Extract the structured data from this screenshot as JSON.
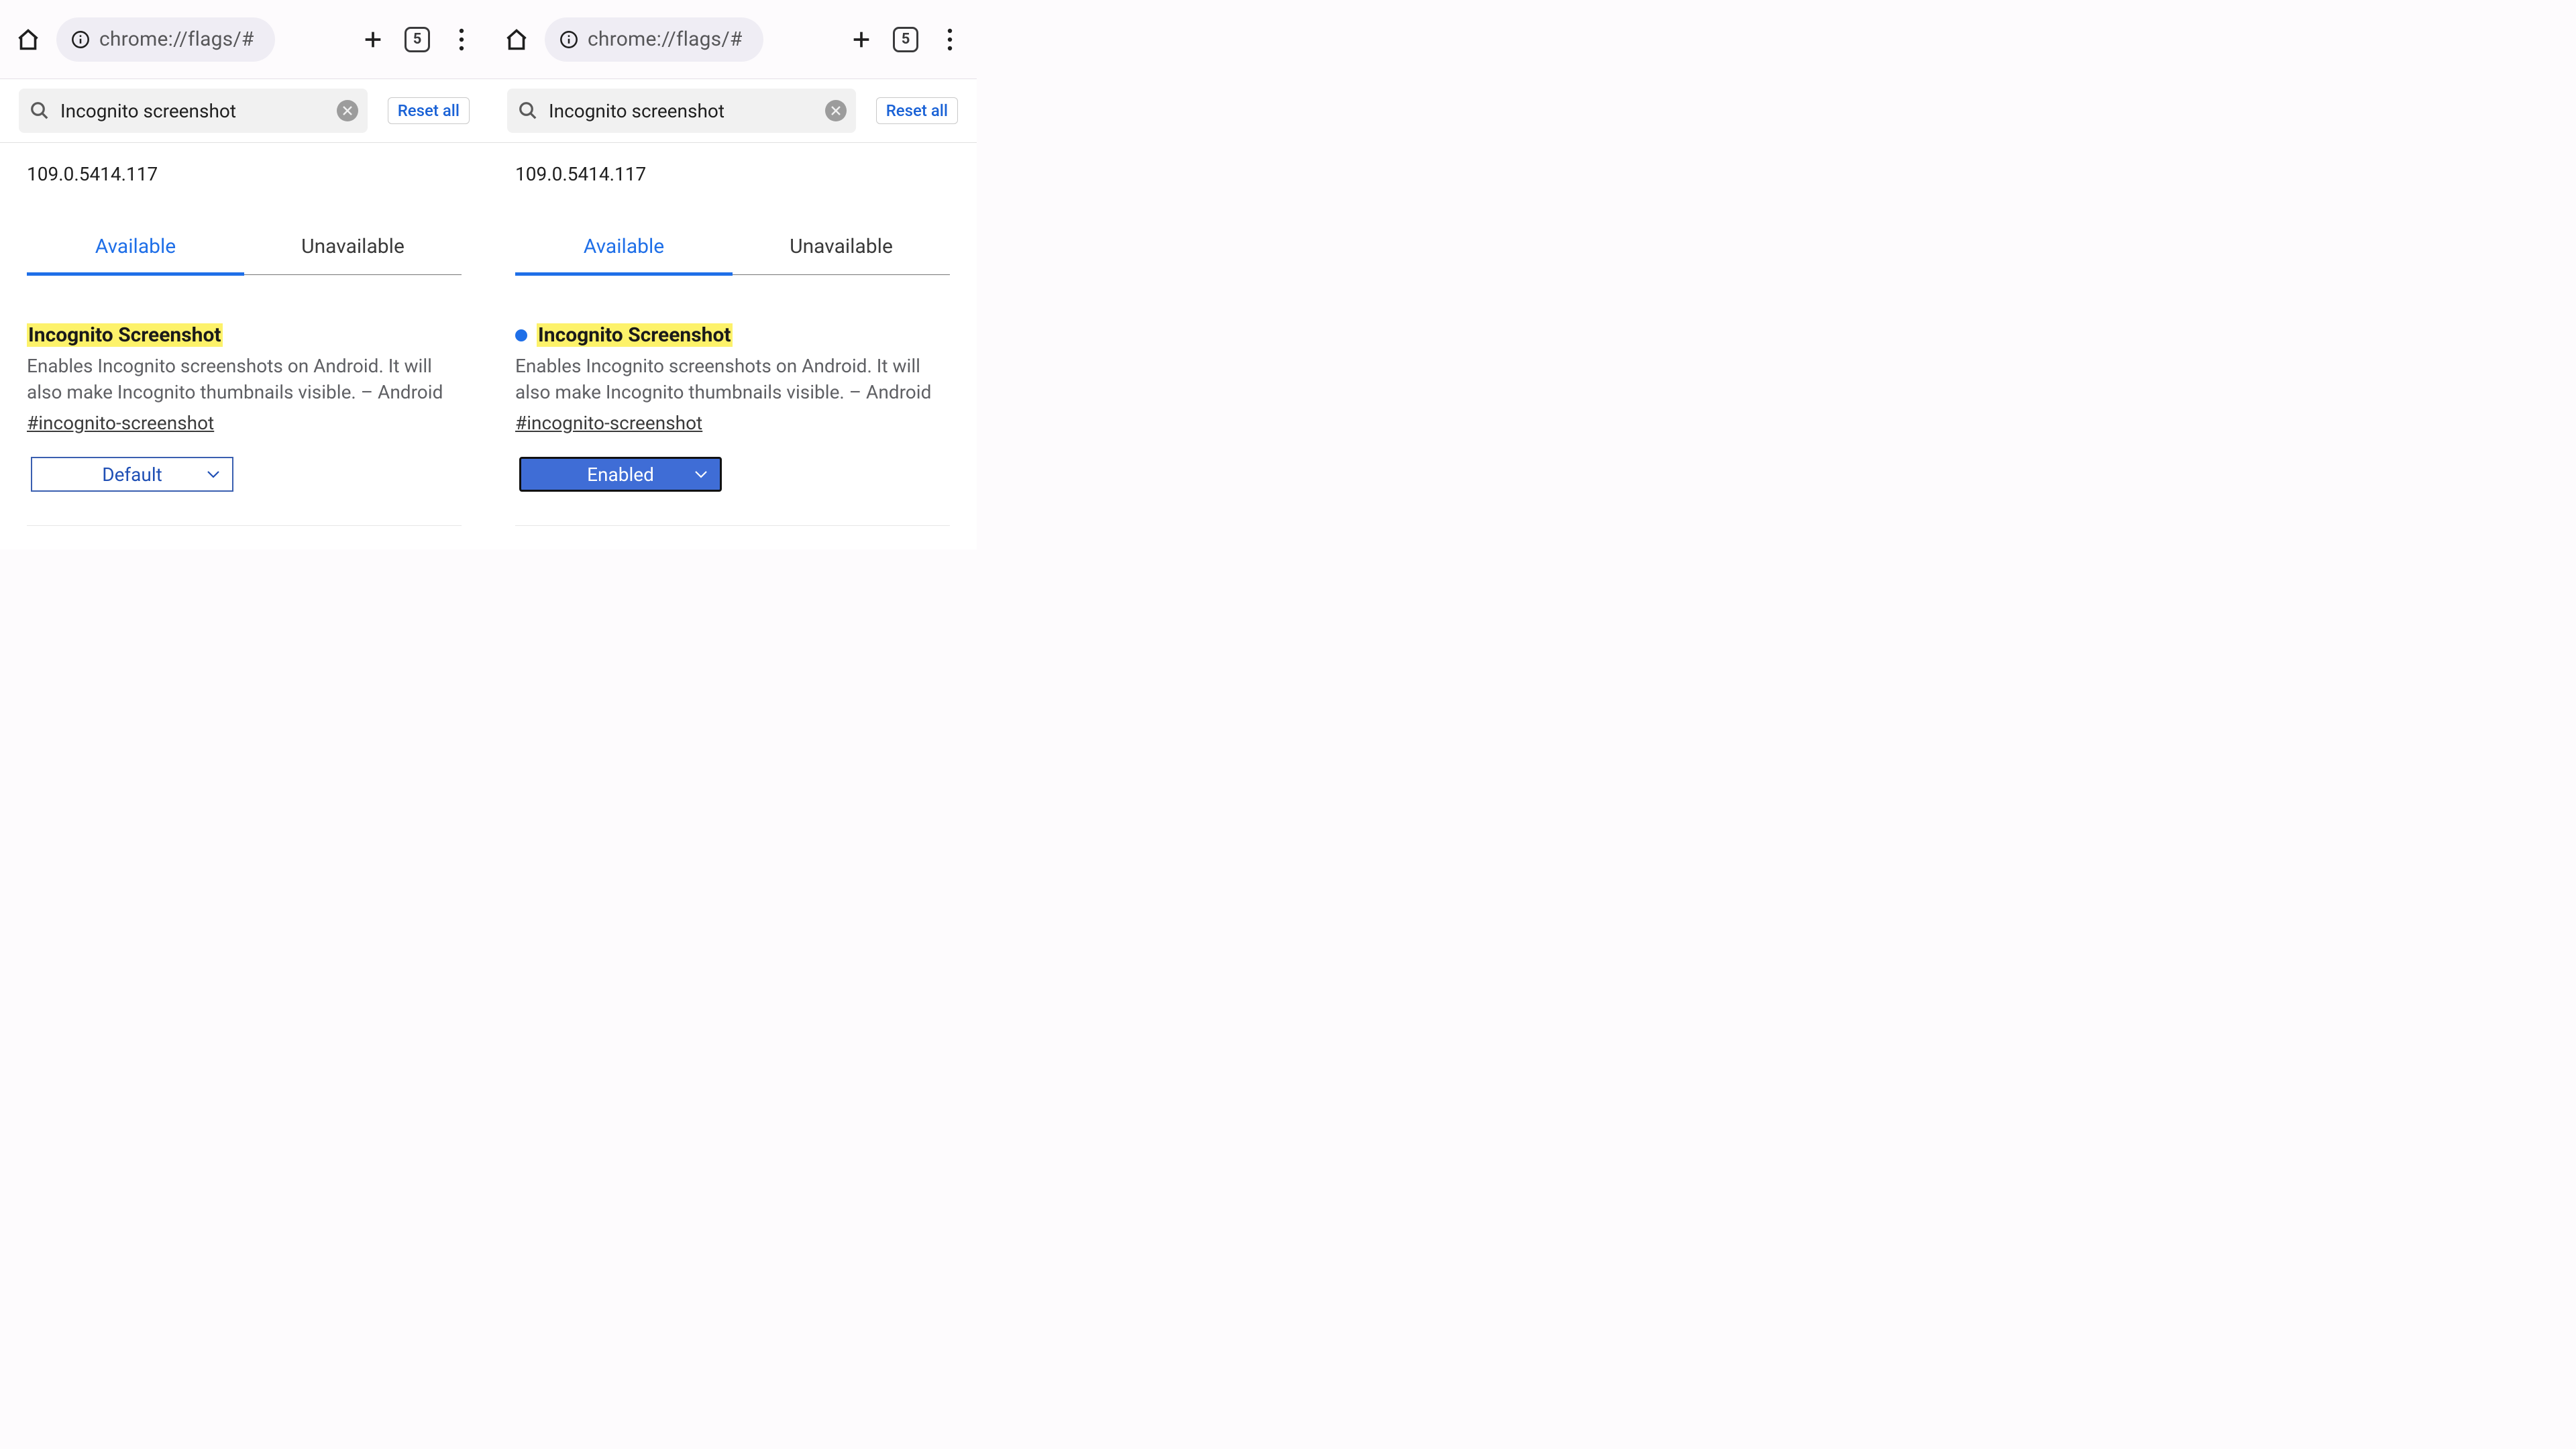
{
  "panes": [
    {
      "url": "chrome://flags/#",
      "tab_count": "5",
      "search_query": "Incognito screenshot",
      "reset_label": "Reset all",
      "version": "109.0.5414.117",
      "tabs": {
        "available": "Available",
        "unavailable": "Unavailable"
      },
      "flag": {
        "modified": false,
        "title": "Incognito Screenshot",
        "description": "Enables Incognito screenshots on Android. It will also make Incognito thumbnails visible. – Android",
        "hash": "#incognito-screenshot",
        "dropdown_value": "Default",
        "dropdown_style": "default"
      }
    },
    {
      "url": "chrome://flags/#",
      "tab_count": "5",
      "search_query": "Incognito screenshot",
      "reset_label": "Reset all",
      "version": "109.0.5414.117",
      "tabs": {
        "available": "Available",
        "unavailable": "Unavailable"
      },
      "flag": {
        "modified": true,
        "title": "Incognito Screenshot",
        "description": "Enables Incognito screenshots on Android. It will also make Incognito thumbnails visible. – Android",
        "hash": "#incognito-screenshot",
        "dropdown_value": "Enabled",
        "dropdown_style": "enabled"
      }
    }
  ]
}
